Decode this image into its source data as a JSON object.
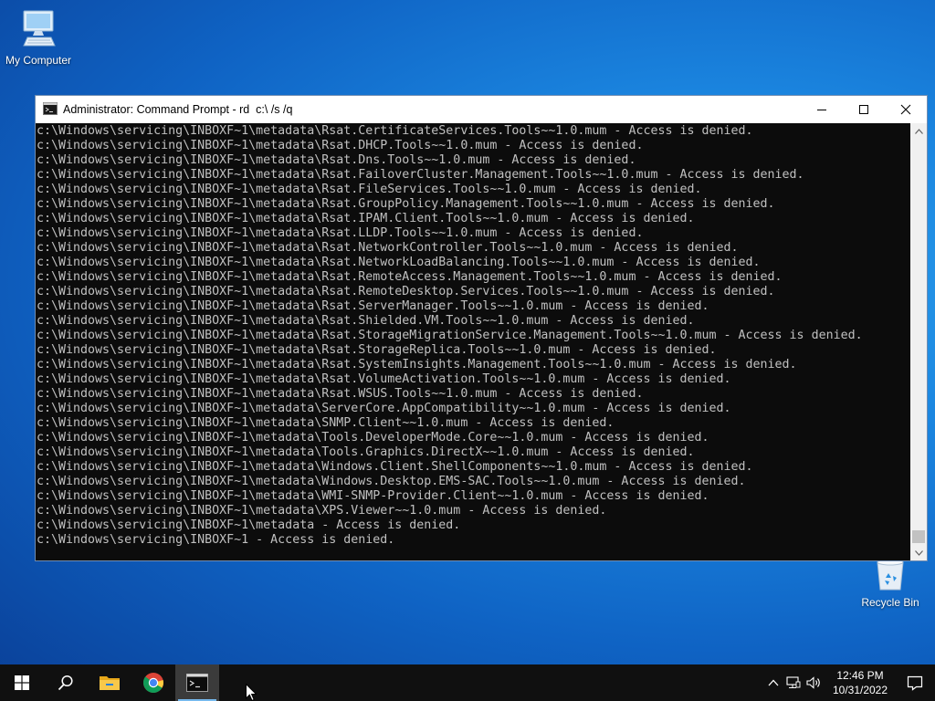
{
  "desktop": {
    "icons": [
      {
        "label": "My Computer",
        "icon": "computer-icon"
      },
      {
        "label": "Recycle Bin",
        "icon": "recycle-bin-icon"
      }
    ]
  },
  "window": {
    "title": "Administrator: Command Prompt - rd  c:\\ /s /q",
    "icon": "cmd-icon",
    "controls": [
      "minimize-icon",
      "maximize-icon",
      "close-icon"
    ],
    "console_lines": [
      "c:\\Windows\\servicing\\INBOXF~1\\metadata\\Rsat.CertificateServices.Tools~~1.0.mum - Access is denied.",
      "c:\\Windows\\servicing\\INBOXF~1\\metadata\\Rsat.DHCP.Tools~~1.0.mum - Access is denied.",
      "c:\\Windows\\servicing\\INBOXF~1\\metadata\\Rsat.Dns.Tools~~1.0.mum - Access is denied.",
      "c:\\Windows\\servicing\\INBOXF~1\\metadata\\Rsat.FailoverCluster.Management.Tools~~1.0.mum - Access is denied.",
      "c:\\Windows\\servicing\\INBOXF~1\\metadata\\Rsat.FileServices.Tools~~1.0.mum - Access is denied.",
      "c:\\Windows\\servicing\\INBOXF~1\\metadata\\Rsat.GroupPolicy.Management.Tools~~1.0.mum - Access is denied.",
      "c:\\Windows\\servicing\\INBOXF~1\\metadata\\Rsat.IPAM.Client.Tools~~1.0.mum - Access is denied.",
      "c:\\Windows\\servicing\\INBOXF~1\\metadata\\Rsat.LLDP.Tools~~1.0.mum - Access is denied.",
      "c:\\Windows\\servicing\\INBOXF~1\\metadata\\Rsat.NetworkController.Tools~~1.0.mum - Access is denied.",
      "c:\\Windows\\servicing\\INBOXF~1\\metadata\\Rsat.NetworkLoadBalancing.Tools~~1.0.mum - Access is denied.",
      "c:\\Windows\\servicing\\INBOXF~1\\metadata\\Rsat.RemoteAccess.Management.Tools~~1.0.mum - Access is denied.",
      "c:\\Windows\\servicing\\INBOXF~1\\metadata\\Rsat.RemoteDesktop.Services.Tools~~1.0.mum - Access is denied.",
      "c:\\Windows\\servicing\\INBOXF~1\\metadata\\Rsat.ServerManager.Tools~~1.0.mum - Access is denied.",
      "c:\\Windows\\servicing\\INBOXF~1\\metadata\\Rsat.Shielded.VM.Tools~~1.0.mum - Access is denied.",
      "c:\\Windows\\servicing\\INBOXF~1\\metadata\\Rsat.StorageMigrationService.Management.Tools~~1.0.mum - Access is denied.",
      "c:\\Windows\\servicing\\INBOXF~1\\metadata\\Rsat.StorageReplica.Tools~~1.0.mum - Access is denied.",
      "c:\\Windows\\servicing\\INBOXF~1\\metadata\\Rsat.SystemInsights.Management.Tools~~1.0.mum - Access is denied.",
      "c:\\Windows\\servicing\\INBOXF~1\\metadata\\Rsat.VolumeActivation.Tools~~1.0.mum - Access is denied.",
      "c:\\Windows\\servicing\\INBOXF~1\\metadata\\Rsat.WSUS.Tools~~1.0.mum - Access is denied.",
      "c:\\Windows\\servicing\\INBOXF~1\\metadata\\ServerCore.AppCompatibility~~1.0.mum - Access is denied.",
      "c:\\Windows\\servicing\\INBOXF~1\\metadata\\SNMP.Client~~1.0.mum - Access is denied.",
      "c:\\Windows\\servicing\\INBOXF~1\\metadata\\Tools.DeveloperMode.Core~~1.0.mum - Access is denied.",
      "c:\\Windows\\servicing\\INBOXF~1\\metadata\\Tools.Graphics.DirectX~~1.0.mum - Access is denied.",
      "c:\\Windows\\servicing\\INBOXF~1\\metadata\\Windows.Client.ShellComponents~~1.0.mum - Access is denied.",
      "c:\\Windows\\servicing\\INBOXF~1\\metadata\\Windows.Desktop.EMS-SAC.Tools~~1.0.mum - Access is denied.",
      "c:\\Windows\\servicing\\INBOXF~1\\metadata\\WMI-SNMP-Provider.Client~~1.0.mum - Access is denied.",
      "c:\\Windows\\servicing\\INBOXF~1\\metadata\\XPS.Viewer~~1.0.mum - Access is denied.",
      "c:\\Windows\\servicing\\INBOXF~1\\metadata - Access is denied.",
      "c:\\Windows\\servicing\\INBOXF~1 - Access is denied."
    ]
  },
  "taskbar": {
    "buttons": [
      "windows-start-icon",
      "search-icon",
      "file-explorer-icon",
      "chrome-icon",
      "command-prompt-icon"
    ],
    "active": "command-prompt-icon",
    "tray_icons": [
      "chevron-up-icon",
      "network-icon",
      "volume-icon"
    ],
    "time": "12:46 PM",
    "date": "10/31/2022"
  },
  "colors": {
    "console_bg": "#0c0c0c",
    "console_text": "#c0c0c0",
    "taskbar_bg": "#101010",
    "accent": "#76b9ed"
  }
}
